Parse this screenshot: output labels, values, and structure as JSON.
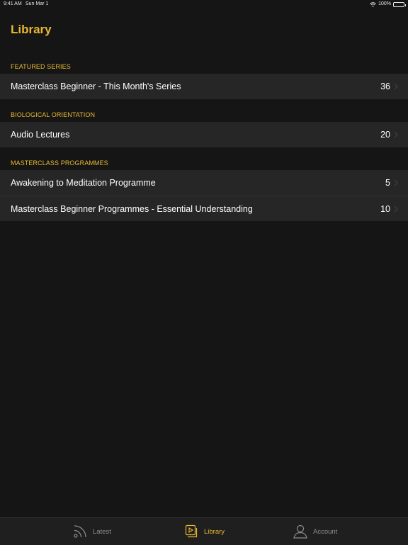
{
  "status": {
    "time": "9:41 AM",
    "date": "Sun Mar 1",
    "battery": "100%"
  },
  "page": {
    "title": "Library"
  },
  "sections": [
    {
      "header": "FEATURED SERIES",
      "rows": [
        {
          "label": "Masterclass Beginner - This Month's Series",
          "count": "36"
        }
      ]
    },
    {
      "header": "BIOLOGICAL ORIENTATION",
      "rows": [
        {
          "label": "Audio Lectures",
          "count": "20"
        }
      ]
    },
    {
      "header": "MASTERCLASS PROGRAMMES",
      "rows": [
        {
          "label": "Awakening to Meditation Programme",
          "count": "5"
        },
        {
          "label": "Masterclass Beginner Programmes - Essential Understanding",
          "count": "10"
        }
      ]
    }
  ],
  "tabs": {
    "latest": {
      "label": "Latest",
      "icon": "rss-icon"
    },
    "library": {
      "label": "Library",
      "icon": "library-icon",
      "active": true
    },
    "account": {
      "label": "Account",
      "icon": "person-icon"
    }
  },
  "colors": {
    "accent": "#e8b931",
    "background": "#151515",
    "row": "#262626"
  }
}
